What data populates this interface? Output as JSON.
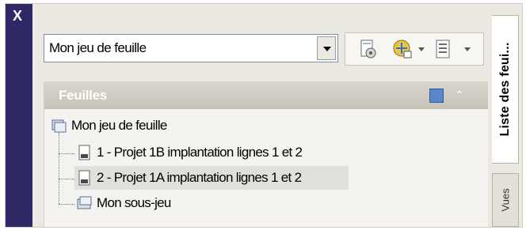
{
  "palette": {
    "left_bar": "#2e2866",
    "panel_header": "#c9c4ba",
    "selected_row": "#e1e0dc"
  },
  "window": {
    "close_label": "X"
  },
  "sheetset_select": {
    "value": "Mon jeu de feuille",
    "dropdown_icon": "chevron-down-icon"
  },
  "toolbar": {
    "buttons": [
      {
        "icon": "sheet-settings-icon",
        "has_dropdown": false
      },
      {
        "icon": "publish-icon",
        "has_dropdown": true
      },
      {
        "icon": "sheet-list-icon",
        "has_dropdown": true
      }
    ]
  },
  "sheets_panel": {
    "title": "Feuilles",
    "tree": [
      {
        "label": "Mon jeu de feuille",
        "icon": "sheet-set-icon",
        "level": 0,
        "selected": false
      },
      {
        "label": "1 - Projet 1B implantation lignes 1 et 2",
        "icon": "sheet-icon",
        "level": 1,
        "selected": false
      },
      {
        "label": "2 - Projet 1A implantation lignes 1 et 2",
        "icon": "sheet-icon",
        "level": 1,
        "selected": true
      },
      {
        "label": "Mon sous-jeu",
        "icon": "subset-icon",
        "level": 1,
        "selected": false
      }
    ]
  },
  "side_tabs": [
    {
      "label": "Liste des feui...",
      "active": true
    },
    {
      "label": "Vues",
      "active": false
    }
  ]
}
